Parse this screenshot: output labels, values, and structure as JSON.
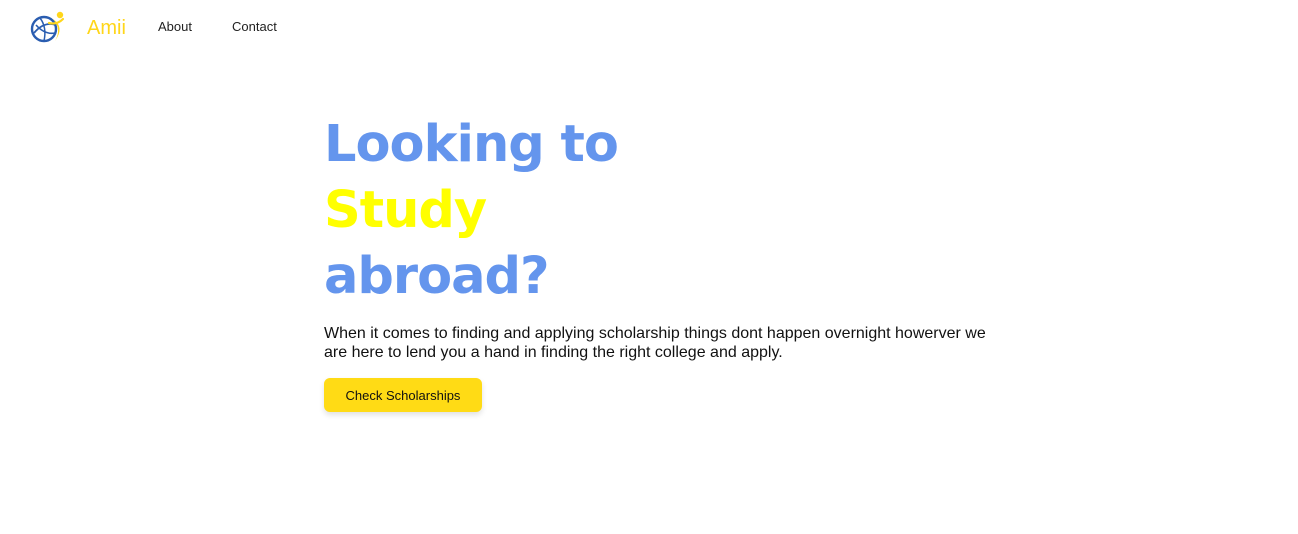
{
  "nav": {
    "brand": "Amii",
    "links": [
      {
        "label": "About"
      },
      {
        "label": "Contact"
      }
    ]
  },
  "hero": {
    "line1": "Looking to",
    "line2": "Study",
    "line3": "abroad?",
    "description": "When it comes to finding and applying scholarship things dont happen overnight howerver we are here to lend you a hand in finding the right college and apply.",
    "cta_label": "Check Scholarships"
  },
  "colors": {
    "brand_yellow": "#ffd61a",
    "headline_blue": "#6495ed",
    "headline_yellow": "#ffff00",
    "button_yellow": "#ffdb15"
  },
  "icons": {
    "logo": "globe-person-logo-icon"
  }
}
